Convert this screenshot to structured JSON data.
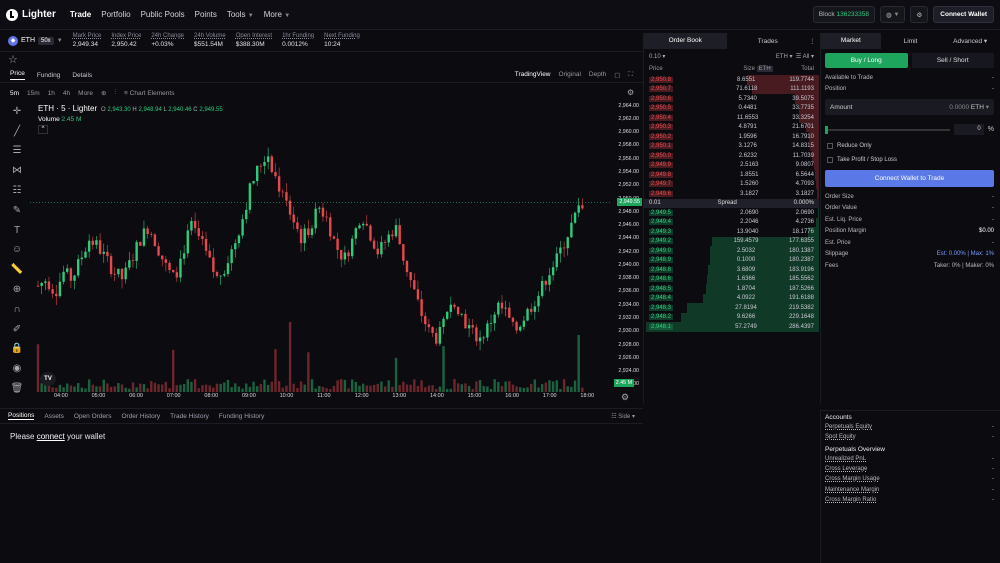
{
  "nav": {
    "brand": "Lighter",
    "items": [
      {
        "label": "Trade",
        "active": true
      },
      {
        "label": "Portfolio"
      },
      {
        "label": "Public Pools"
      },
      {
        "label": "Points"
      },
      {
        "label": "Tools"
      },
      {
        "label": "More"
      }
    ]
  },
  "header": {
    "block_label": "Block",
    "block_number": "136233358",
    "connect": "Connect Wallet"
  },
  "ticker": {
    "symbol": "ETH",
    "leverage": "50x",
    "stats": [
      {
        "label": "Mark Price",
        "value": "2,949.34"
      },
      {
        "label": "Index Price",
        "value": "2,950.42"
      },
      {
        "label": "24h Change",
        "value": "+0.03%"
      },
      {
        "label": "24h Volume",
        "value": "$551.54M"
      },
      {
        "label": "Open Interest",
        "value": "$388.30M"
      },
      {
        "label": "1hr Funding",
        "value": "0.0012%"
      },
      {
        "label": "Next Funding",
        "value": "10:24"
      }
    ]
  },
  "chart_tabs": {
    "tabs": [
      "Price",
      "Funding",
      "Details"
    ],
    "views": [
      "TradingView",
      "Original",
      "Depth"
    ]
  },
  "toolbar": {
    "intervals": [
      "5m",
      "15m",
      "1h",
      "4h",
      "More"
    ],
    "elements": "Chart Elements"
  },
  "legend": {
    "title": "ETH · 5 · Lighter",
    "o": "O",
    "o_val": "2,943.30",
    "h": "H",
    "h_val": "2,948.94",
    "l": "L",
    "l_val": "2,940.46",
    "c": "C",
    "c_val": "2,949.55",
    "volume": "Volume",
    "volume_val": "2.45 M"
  },
  "price_ticks": [
    "2,964.00",
    "2,962.00",
    "2,960.00",
    "2,958.00",
    "2,956.00",
    "2,954.00",
    "2,952.00",
    "2,950.00",
    "2,948.00",
    "2,946.00",
    "2,944.00",
    "2,942.00",
    "2,940.00",
    "2,938.00",
    "2,936.00",
    "2,934.00",
    "2,932.00",
    "2,930.00",
    "2,928.00",
    "2,926.00",
    "2,924.00",
    "2,922.00"
  ],
  "current_price_label": "2,949.55",
  "volume_label": "2.45 M",
  "time_ticks": [
    "04:00",
    "05:00",
    "06:00",
    "07:00",
    "08:00",
    "09:00",
    "10:00",
    "11:00",
    "12:00",
    "13:00",
    "14:00",
    "15:00",
    "16:00",
    "17:00",
    "18:00"
  ],
  "tv_logo": "TV",
  "bottom": {
    "tabs": [
      "Positions",
      "Assets",
      "Open Orders",
      "Order History",
      "Trade History",
      "Funding History"
    ],
    "side": "Side",
    "note_pre": "Please ",
    "note_link": "connect",
    "note_post": " your wallet"
  },
  "orderbook": {
    "tabs": [
      "Order Book",
      "Trades"
    ],
    "tick": "0.10",
    "asset": "ETH",
    "filter": "All",
    "col_price": "Price",
    "col_size": "Size",
    "col_size_unit": "ETH",
    "col_total": "Total",
    "asks": [
      [
        "2,950.8",
        "8.6551",
        "119.7744"
      ],
      [
        "2,950.7",
        "71.6118",
        "111.1193"
      ],
      [
        "2,950.6",
        "5.7340",
        "39.5075"
      ],
      [
        "2,950.5",
        "0.4481",
        "33.7735"
      ],
      [
        "2,950.4",
        "11.6553",
        "33.3254"
      ],
      [
        "2,950.3",
        "4.8791",
        "21.6701"
      ],
      [
        "2,950.2",
        "1.9596",
        "16.7910"
      ],
      [
        "2,950.1",
        "3.1276",
        "14.8315"
      ],
      [
        "2,950.0",
        "2.6232",
        "11.7039"
      ],
      [
        "2,949.9",
        "2.5163",
        "9.0807"
      ],
      [
        "2,949.8",
        "1.8551",
        "6.5644"
      ],
      [
        "2,949.7",
        "1.5260",
        "4.7093"
      ],
      [
        "2,949.6",
        "3.1827",
        "3.1827"
      ]
    ],
    "spread": {
      "value": "0.01",
      "label": "Spread",
      "pct": "0.000%"
    },
    "bids": [
      [
        "2,949.5",
        "2.0690",
        "2.0690"
      ],
      [
        "2,949.4",
        "2.2046",
        "4.2736"
      ],
      [
        "2,949.3",
        "13.9040",
        "18.1776"
      ],
      [
        "2,949.2",
        "159.4579",
        "177.6355"
      ],
      [
        "2,949.0",
        "2.5032",
        "180.1387"
      ],
      [
        "2,948.9",
        "0.1000",
        "180.2387"
      ],
      [
        "2,948.8",
        "3.6809",
        "183.9196"
      ],
      [
        "2,948.6",
        "1.6366",
        "185.5562"
      ],
      [
        "2,948.5",
        "1.8704",
        "187.5266"
      ],
      [
        "2,948.4",
        "4.0922",
        "191.6188"
      ],
      [
        "2,948.3",
        "27.8194",
        "219.5382"
      ],
      [
        "2,948.2",
        "9.6266",
        "229.1648"
      ],
      [
        "2,948.1",
        "57.2749",
        "286.4397"
      ]
    ]
  },
  "trade": {
    "tabs": [
      "Market",
      "Limit",
      "Advanced"
    ],
    "buy": "Buy / Long",
    "sell": "Sell / Short",
    "info1": [
      [
        "Available to Trade",
        "-"
      ],
      [
        "Position",
        "-"
      ]
    ],
    "amount_label": "Amount",
    "amount_val": "0.0000",
    "amount_unit": "ETH",
    "pct": "0",
    "pct_unit": "%",
    "reduce_only": "Reduce Only",
    "tpsl": "Take Profit / Stop Loss",
    "connect": "Connect Wallet to Trade",
    "info2": [
      [
        "Order Size",
        "-"
      ],
      [
        "Order Value",
        "-"
      ],
      [
        "Est. Liq. Price",
        "-"
      ],
      [
        "Position Margin",
        "$0.00"
      ],
      [
        "Est. Price",
        "-"
      ]
    ],
    "slippage_label": "Slippage",
    "slippage_val": "Est: 0.00% | Max: 1%",
    "fees_label": "Fees",
    "fees_val": "Taker: 0% | Maker: 0%"
  },
  "accounts": {
    "title": "Accounts",
    "rows": [
      [
        "Perpetuals Equity",
        "-"
      ],
      [
        "Spot Equity",
        "-"
      ]
    ],
    "overview": "Perpetuals Overview",
    "rows2": [
      [
        "Unrealized PnL",
        "-"
      ],
      [
        "Cross Leverage",
        "-"
      ],
      [
        "Cross Margin Usage",
        "-"
      ],
      [
        "Maintenance Margin",
        "-"
      ],
      [
        "Cross Margin Ratio",
        "-"
      ]
    ]
  },
  "colors": {
    "up": "#2ecb7b",
    "down": "#e5484d",
    "accent": "#5a79e6",
    "buy": "#1fa45e"
  },
  "chart_data": {
    "type": "candlestick",
    "x_range": [
      "04:00",
      "18:00"
    ],
    "ylim": [
      2921,
      2965
    ],
    "close_series": [
      2937,
      2938,
      2936,
      2939,
      2938,
      2941,
      2944,
      2943,
      2941,
      2939,
      2938,
      2941,
      2944,
      2946,
      2943,
      2940,
      2938,
      2942,
      2946,
      2944,
      2941,
      2938,
      2940,
      2943,
      2947,
      2952,
      2955,
      2957,
      2953,
      2950,
      2947,
      2944,
      2946,
      2949,
      2947,
      2943,
      2941,
      2944,
      2948,
      2945,
      2942,
      2944,
      2946,
      2941,
      2937,
      2933,
      2930,
      2929,
      2932,
      2935,
      2932,
      2930,
      2929,
      2931,
      2934,
      2933,
      2930,
      2932,
      2934,
      2936,
      2939,
      2941,
      2944,
      2947,
      2949.55
    ]
  }
}
